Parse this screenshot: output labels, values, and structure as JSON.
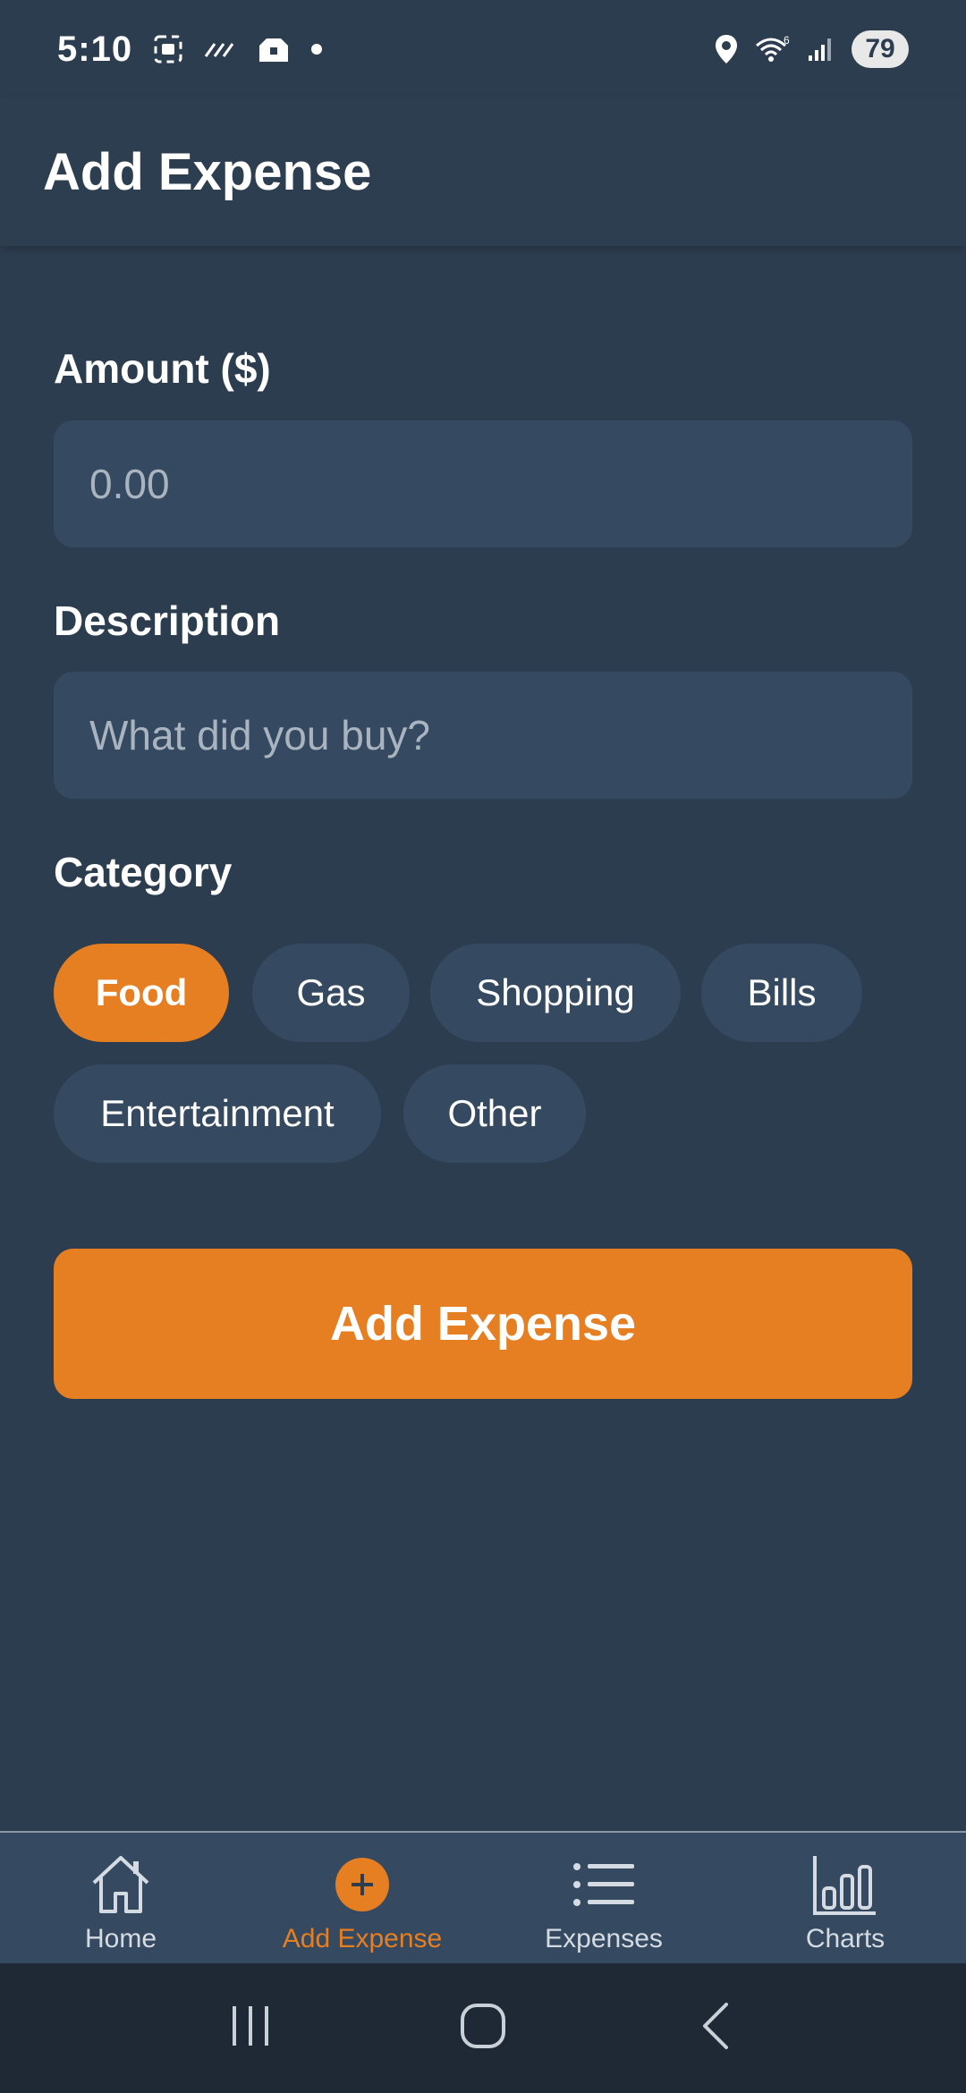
{
  "status_bar": {
    "time": "5:10",
    "battery": "79",
    "icons": [
      "screenshot-icon",
      "signal-lines-icon",
      "tray-icon",
      "dot-icon",
      "location-icon",
      "wifi-icon",
      "cell-signal-icon"
    ]
  },
  "header": {
    "title": "Add Expense"
  },
  "form": {
    "amount_label": "Amount ($)",
    "amount_placeholder": "0.00",
    "amount_value": "",
    "description_label": "Description",
    "description_placeholder": "What did you buy?",
    "description_value": "",
    "category_label": "Category",
    "categories": [
      "Food",
      "Gas",
      "Shopping",
      "Bills",
      "Entertainment",
      "Other"
    ],
    "selected_category": "Food",
    "submit_label": "Add Expense"
  },
  "tabs": [
    {
      "label": "Home",
      "icon": "home-icon",
      "active": false
    },
    {
      "label": "Add Expense",
      "icon": "add-circle-icon",
      "active": true
    },
    {
      "label": "Expenses",
      "icon": "list-icon",
      "active": false
    },
    {
      "label": "Charts",
      "icon": "bar-chart-icon",
      "active": false
    }
  ],
  "colors": {
    "accent": "#e67e22",
    "background": "#2d3d50",
    "surface": "#354a60",
    "nav_bar": "#1f2935"
  }
}
